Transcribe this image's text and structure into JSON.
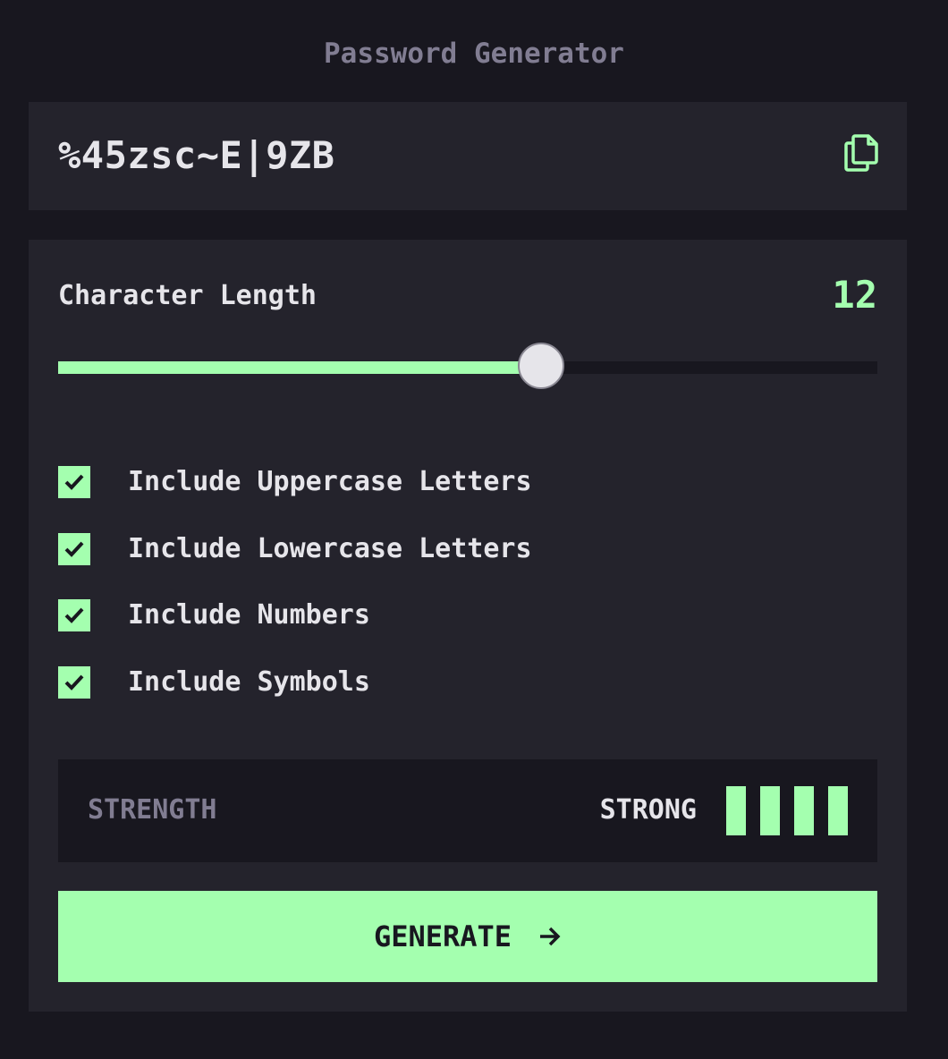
{
  "app": {
    "title": "Password Generator"
  },
  "output": {
    "password": "%45zsc~E|9ZB",
    "copy_icon": "copy-icon"
  },
  "length": {
    "label": "Character Length",
    "value": "12",
    "slider_fraction": 0.59
  },
  "options": [
    {
      "label": "Include Uppercase Letters",
      "checked": true
    },
    {
      "label": "Include Lowercase Letters",
      "checked": true
    },
    {
      "label": "Include Numbers",
      "checked": true
    },
    {
      "label": "Include Symbols",
      "checked": true
    }
  ],
  "strength": {
    "label": "STRENGTH",
    "value": "STRONG",
    "level": 4,
    "max_level": 4
  },
  "generate": {
    "label": "GENERATE",
    "icon": "arrow-right-icon"
  },
  "colors": {
    "background": "#18171f",
    "panel": "#24232c",
    "accent": "#a4ffaf",
    "text": "#e6e5ea",
    "muted": "#817d92"
  }
}
